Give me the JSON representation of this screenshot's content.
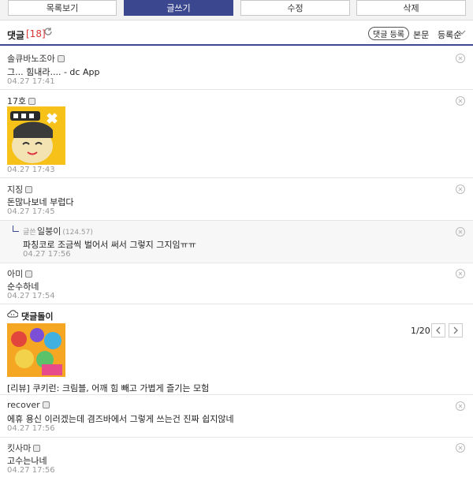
{
  "toolbar": {
    "list_btn": "목록보기",
    "write_btn": "글쓰기",
    "edit_btn": "수정",
    "delete_btn": "삭제"
  },
  "comments_header": {
    "title": "댓글",
    "count": "[18]",
    "register_btn": "댓글 등록",
    "sort_body": "본문",
    "sort_order": "등록순"
  },
  "comments": [
    {
      "nick": "솔큐바노조아",
      "body": "그... 힘내라.... - dc App",
      "date": "04.27 17:41"
    },
    {
      "nick": "17호",
      "body": "",
      "date": "04.27 17:43"
    },
    {
      "nick": "지징",
      "body": "돈많나보네 부럽다",
      "date": "04.27 17:45"
    },
    {
      "nick": "일붕이",
      "ip": "(124.57)",
      "tag": "글쓴",
      "body": "파칭코로 조금씩 벌어서 써서 그렇지 그지임ㅠㅠ",
      "date": "04.27 17:56"
    },
    {
      "nick": "아미",
      "body": "순수하네",
      "date": "04.27 17:54"
    },
    {
      "nick": "recover",
      "body": "에휴 용신 이러겠는데 겸즈바에서 그렇게 쓰는건 진짜 쉽지않네",
      "date": "04.27 17:56"
    },
    {
      "nick": "킷사마",
      "body": "고수는나네",
      "date": "04.27 17:56"
    }
  ],
  "bot": {
    "title": "댓글돌이",
    "pager": "1/20",
    "caption": "[리뷰] 쿠키런: 크림블, 어깨 힘 빼고 가볍게 즐기는 모험"
  },
  "colors": {
    "accent": "#3b4890",
    "count": "#dd3333"
  }
}
